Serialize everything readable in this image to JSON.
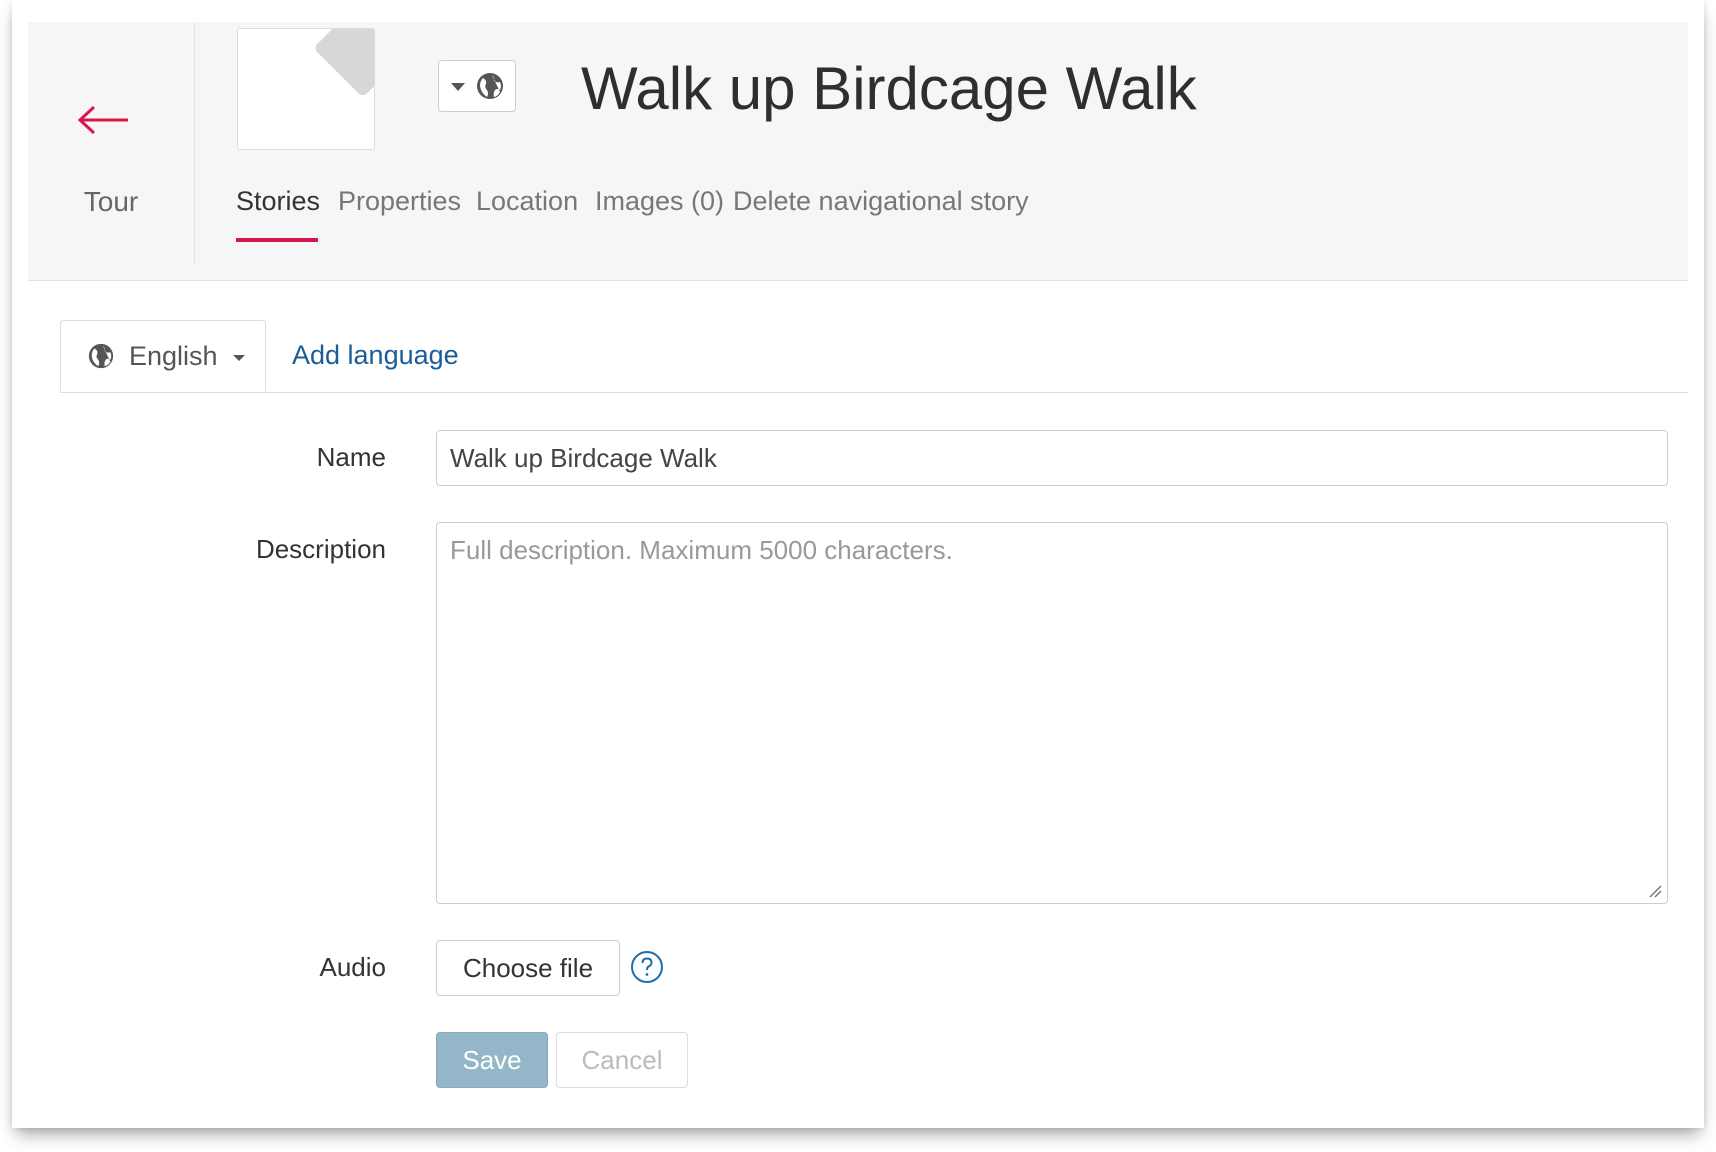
{
  "colors": {
    "accent": "#d6174a",
    "link": "#1a5d99",
    "save_button": "#93b6c9"
  },
  "header": {
    "back_icon": "arrow-left-icon",
    "back_label": "Tour",
    "thumbnail_icon": "turn-right-sign-icon",
    "language_switch_icons": [
      "caret-down-icon",
      "globe-icon"
    ],
    "title": "Walk up Birdcage Walk",
    "tabs": [
      {
        "label": "Stories",
        "active": true
      },
      {
        "label": "Properties",
        "active": false
      },
      {
        "label": "Location",
        "active": false
      },
      {
        "label": "Images (0)",
        "active": false
      },
      {
        "label": "Delete navigational story",
        "active": false
      }
    ]
  },
  "language_tabs": {
    "current": "English",
    "current_icon": "globe-icon",
    "add_label": "Add language"
  },
  "form": {
    "name_label": "Name",
    "name_value": "Walk up Birdcage Walk",
    "description_label": "Description",
    "description_value": "",
    "description_placeholder": "Full description. Maximum 5000 characters.",
    "audio_label": "Audio",
    "choose_file_label": "Choose file",
    "help_icon": "question-circle-icon",
    "save_label": "Save",
    "cancel_label": "Cancel"
  }
}
